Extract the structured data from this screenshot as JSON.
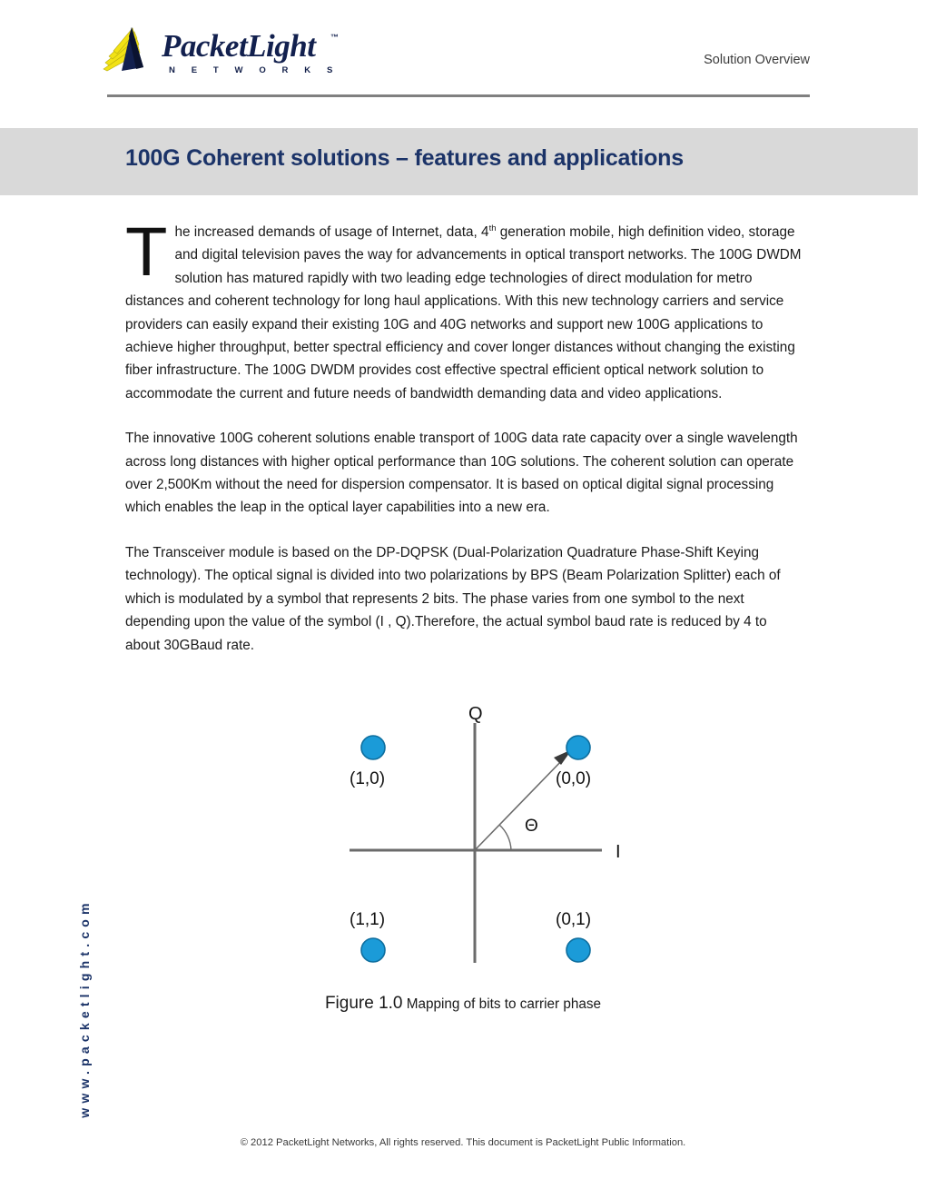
{
  "header": {
    "brand_name": "PacketLight",
    "brand_tagline": "N E T W O R K S",
    "trademark": "™",
    "doc_type": "Solution Overview"
  },
  "banner": {
    "title": "100G Coherent solutions – features and applications",
    "background_color": "#D9D9D9",
    "title_color": "#1B3368"
  },
  "body": {
    "paragraph1_dropcap": "T",
    "paragraph1_a": "he increased demands of usage of Internet, data,  4",
    "paragraph1_sup": "th",
    "paragraph1_b": " generation mobile, high definition video, storage and digital television paves the way for advancements in optical transport networks.  The 100G DWDM solution has matured rapidly with two leading edge technologies of direct modulation for metro distances and coherent technology for long haul applications. With this new technology carriers and service providers can easily expand their existing 10G and 40G networks and support new 100G applications to achieve higher throughput, better spectral efficiency and cover longer distances without changing the existing fiber infrastructure. The 100G DWDM provides cost effective spectral efficient optical network solution to accommodate the current and future needs of bandwidth demanding data and video applications.",
    "paragraph2": "The innovative 100G coherent solutions enable transport of 100G data rate capacity over a single wavelength across long distances with higher optical performance than 10G solutions. The coherent solution can operate over 2,500Km without the need for dispersion compensator.  It is based on optical digital signal processing which enables the leap in the optical layer capabilities into a new era.",
    "paragraph3": "The Transceiver module is based on the DP-DQPSK (Dual-Polarization Quadrature Phase-Shift Keying technology). The optical signal is divided into two polarizations by BPS (Beam Polarization Splitter) each of which is modulated by a symbol that represents 2 bits.  The phase varies from one symbol to the next depending upon the value of the symbol (I , Q).Therefore, the actual symbol baud rate is reduced by 4 to about 30GBaud rate."
  },
  "figure": {
    "number": "Figure 1.0",
    "caption": "Mapping of bits to carrier phase",
    "axis_y_label": "Q",
    "axis_x_label": "I",
    "angle_label": "Θ",
    "point_color": "#1B9BD8",
    "point_border_color": "#0E6E9E",
    "axis_color": "#6B6B6B",
    "points": [
      {
        "label": "(1,0)",
        "quadrant": "upper-left",
        "i": -1,
        "q": 1
      },
      {
        "label": "(0,0)",
        "quadrant": "upper-right",
        "i": 1,
        "q": 1
      },
      {
        "label": "(1,1)",
        "quadrant": "lower-left",
        "i": -1,
        "q": -1
      },
      {
        "label": "(0,1)",
        "quadrant": "lower-right",
        "i": 1,
        "q": -1
      }
    ]
  },
  "sidebar": {
    "url": "www.packetlight.com"
  },
  "footer": {
    "copyright": "© 2012 PacketLight Networks, All rights reserved. This document is PacketLight Public Information."
  }
}
